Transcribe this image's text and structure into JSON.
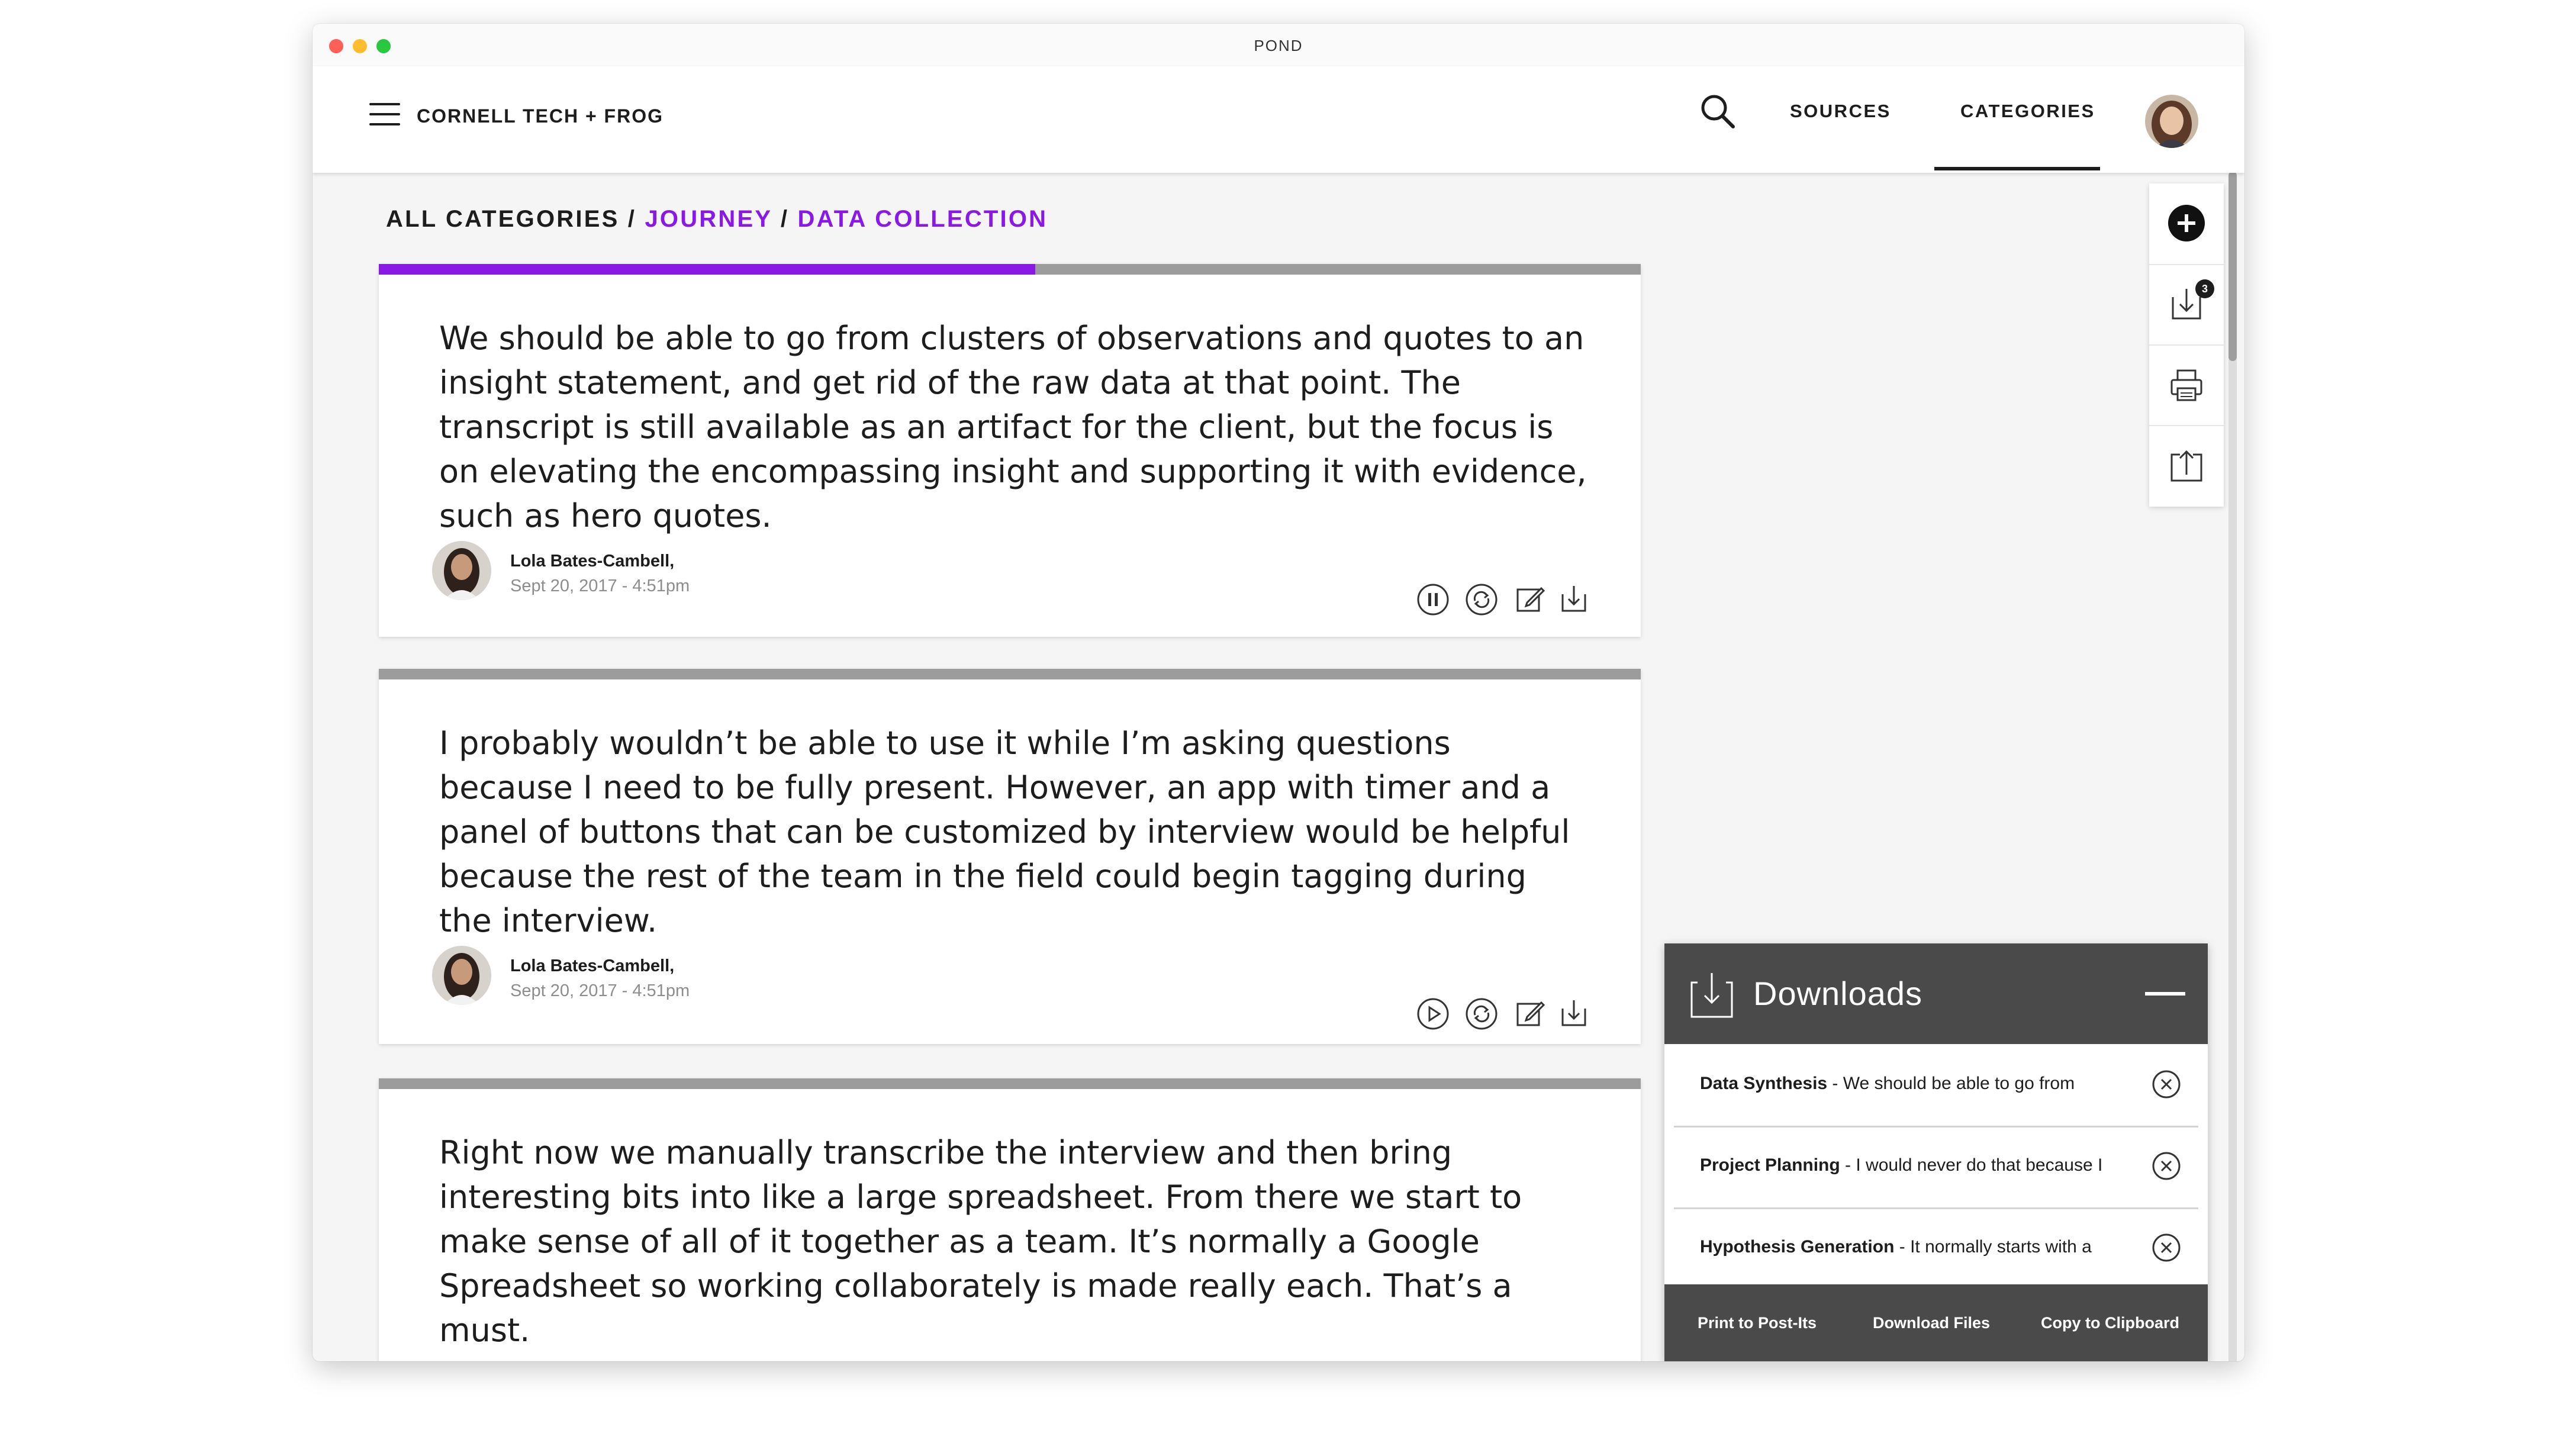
{
  "window": {
    "title": "POND"
  },
  "appbar": {
    "brand": "CORNELL TECH + FROG",
    "nav": {
      "sources": "SOURCES",
      "categories": "CATEGORIES"
    }
  },
  "breadcrumb": {
    "root": "ALL CATEGORIES",
    "separator": "/",
    "level1": "JOURNEY",
    "level2": "DATA COLLECTION"
  },
  "colors": {
    "accent": "#8a19e6",
    "panel_dark": "#4a4a4a",
    "bar_gray": "#9c9c9c"
  },
  "cards": [
    {
      "text": "We should be able to go from clusters of observations and quotes to an insight statement, and get rid of the raw data at that point. The transcript is still available as an artifact for the client, but the focus is on elevating the encompassing insight and supporting it with evidence, such as hero quotes.",
      "author": "Lola Bates-Cambell,",
      "date": "Sept 20, 2017 - 4:51pm",
      "progress": 0.52,
      "media_icon": "pause-icon"
    },
    {
      "text": "I probably wouldn’t be able to use it while I’m asking questions because I need to be fully present. However, an app with timer and a panel of buttons that can be customized by interview would be helpful because the rest of the team in the field could begin tagging during the interview.",
      "author": "Lola Bates-Cambell,",
      "date": "Sept 20, 2017 - 4:51pm",
      "progress": 0,
      "media_icon": "play-icon"
    },
    {
      "text": "Right now we manually transcribe the interview and then bring interesting bits into like a large spreadsheet. From there we start to make sense of all of it together as a team. It’s normally a Google Spreadsheet so working collaborately is made really each. That’s a must.",
      "progress": 0
    }
  ],
  "toolbar": {
    "download_badge": "3"
  },
  "downloads": {
    "title": "Downloads",
    "items": [
      {
        "category": "Data Synthesis",
        "excerpt": " - We should be able to go from"
      },
      {
        "category": "Project Planning",
        "excerpt": " - I would never do that because I"
      },
      {
        "category": "Hypothesis Generation",
        "excerpt": " - It normally starts with a"
      }
    ],
    "actions": {
      "print": "Print to Post-Its",
      "download": "Download Files",
      "copy": "Copy to Clipboard"
    }
  }
}
